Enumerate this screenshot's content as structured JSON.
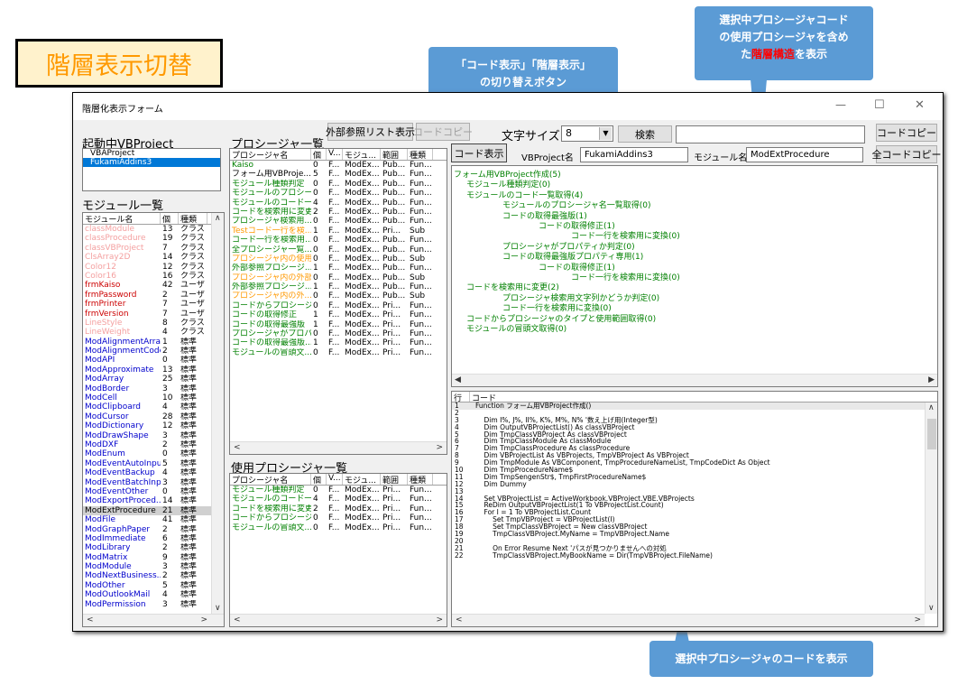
{
  "banner": "階層表示切替",
  "callouts": {
    "toggle": "「コード表示」「階層表示」\nの切り替えボタン",
    "hier_a": "選択中プロシージャコード\nの使用プロシージャを含め\nた",
    "hier_red": "階層構造",
    "hier_b": "を表示",
    "code": "選択中プロシージャのコードを表示"
  },
  "window": {
    "title": "階層化表示フォーム",
    "minimize": "—",
    "maximize": "☐",
    "close": "✕"
  },
  "left": {
    "running_label": "起動中VBProject",
    "projects": [
      "VBAProject",
      "FukamiAddins3"
    ],
    "module_label": "モジュール一覧",
    "module_cols": [
      "モジュール名",
      "個",
      "種類"
    ],
    "modules": [
      [
        "classModule",
        "13",
        "クラス",
        "#f4a0a0"
      ],
      [
        "classProcedure",
        "19",
        "クラス",
        "#f4a0a0"
      ],
      [
        "classVBProject",
        "7",
        "クラス",
        "#f4a0a0"
      ],
      [
        "ClsArray2D",
        "14",
        "クラス",
        "#f4a0a0"
      ],
      [
        "Color12",
        "12",
        "クラス",
        "#f4a0a0"
      ],
      [
        "Color16",
        "16",
        "クラス",
        "#f4a0a0"
      ],
      [
        "frmKaiso",
        "42",
        "ユーザ",
        "#cc0000"
      ],
      [
        "frmPassword",
        "2",
        "ユーザ",
        "#cc0000"
      ],
      [
        "frmPrinter",
        "7",
        "ユーザ",
        "#cc0000"
      ],
      [
        "frmVersion",
        "7",
        "ユーザ",
        "#cc0000"
      ],
      [
        "LineStyle",
        "8",
        "クラス",
        "#f4a0a0"
      ],
      [
        "LineWeight",
        "4",
        "クラス",
        "#f4a0a0"
      ],
      [
        "ModAlignmentArray",
        "1",
        "標準",
        "#0000cc"
      ],
      [
        "ModAlignmentCode",
        "2",
        "標準",
        "#0000cc"
      ],
      [
        "ModAPI",
        "0",
        "標準",
        "#0000cc"
      ],
      [
        "ModApproximate",
        "13",
        "標準",
        "#0000cc"
      ],
      [
        "ModArray",
        "25",
        "標準",
        "#0000cc"
      ],
      [
        "ModBorder",
        "3",
        "標準",
        "#0000cc"
      ],
      [
        "ModCell",
        "10",
        "標準",
        "#0000cc"
      ],
      [
        "ModClipboard",
        "4",
        "標準",
        "#0000cc"
      ],
      [
        "ModCursor",
        "28",
        "標準",
        "#0000cc"
      ],
      [
        "ModDictionary",
        "12",
        "標準",
        "#0000cc"
      ],
      [
        "ModDrawShape",
        "3",
        "標準",
        "#0000cc"
      ],
      [
        "ModDXF",
        "2",
        "標準",
        "#0000cc"
      ],
      [
        "ModEnum",
        "0",
        "標準",
        "#0000cc"
      ],
      [
        "ModEventAutoInput",
        "5",
        "標準",
        "#0000cc"
      ],
      [
        "ModEventBackup",
        "4",
        "標準",
        "#0000cc"
      ],
      [
        "ModEventBatchInp...",
        "3",
        "標準",
        "#0000cc"
      ],
      [
        "ModEventOther",
        "0",
        "標準",
        "#0000cc"
      ],
      [
        "ModExportProced...",
        "14",
        "標準",
        "#0000cc"
      ],
      [
        "ModExtProcedure",
        "21",
        "標準",
        "#000000"
      ],
      [
        "ModFile",
        "41",
        "標準",
        "#0000cc"
      ],
      [
        "ModGraphPaper",
        "2",
        "標準",
        "#0000cc"
      ],
      [
        "ModImmediate",
        "6",
        "標準",
        "#0000cc"
      ],
      [
        "ModLibrary",
        "2",
        "標準",
        "#0000cc"
      ],
      [
        "ModMatrix",
        "9",
        "標準",
        "#0000cc"
      ],
      [
        "ModModule",
        "3",
        "標準",
        "#0000cc"
      ],
      [
        "ModNextBusiness...",
        "2",
        "標準",
        "#0000cc"
      ],
      [
        "ModOther",
        "5",
        "標準",
        "#0000cc"
      ],
      [
        "ModOutlookMail",
        "4",
        "標準",
        "#0000cc"
      ],
      [
        "ModPermission",
        "3",
        "標準",
        "#0000cc"
      ]
    ]
  },
  "middle": {
    "proc_label": "プロシージャ一覧",
    "ext_ref_button": "外部参照リスト表示",
    "code_copy_disabled": "コードコピー",
    "proc_cols": [
      "プロシージャ名",
      "個",
      "V...",
      "モジュ...",
      "範囲",
      "種類"
    ],
    "procs": [
      [
        "Kaiso",
        "0",
        "F...",
        "ModEx...",
        "Pub...",
        "Fun...",
        "#008000"
      ],
      [
        "フォーム用VBProje...",
        "5",
        "F...",
        "ModEx...",
        "Pub...",
        "Fun...",
        "#000000"
      ],
      [
        "モジュール種類判定",
        "0",
        "F...",
        "ModEx...",
        "Pub...",
        "Fun...",
        "#008000"
      ],
      [
        "モジュールのプロシー...",
        "0",
        "F...",
        "ModEx...",
        "Pub...",
        "Fun...",
        "#008000"
      ],
      [
        "モジュールのコード一...",
        "4",
        "F...",
        "ModEx...",
        "Pub...",
        "Fun...",
        "#008000"
      ],
      [
        "コードを検索用に変更",
        "2",
        "F...",
        "ModEx...",
        "Pub...",
        "Fun...",
        "#008000"
      ],
      [
        "プロシージャ検索用...",
        "0",
        "F...",
        "ModEx...",
        "Pub...",
        "Fun...",
        "#008000"
      ],
      [
        "Testコード一行を検...",
        "1",
        "F...",
        "ModEx...",
        "Pri...",
        "Sub",
        "#ff9900"
      ],
      [
        "コード一行を検索用...",
        "0",
        "F...",
        "ModEx...",
        "Pub...",
        "Fun...",
        "#008000"
      ],
      [
        "全プロシージャ一覧...",
        "0",
        "F...",
        "ModEx...",
        "Pub...",
        "Fun...",
        "#008000"
      ],
      [
        "プロシージャ内の使用...",
        "0",
        "F...",
        "ModEx...",
        "Pub...",
        "Sub",
        "#ff9900"
      ],
      [
        "外部参照プロシージ...",
        "1",
        "F...",
        "ModEx...",
        "Pub...",
        "Fun...",
        "#008000"
      ],
      [
        "プロシージャ内の外部...",
        "0",
        "F...",
        "ModEx...",
        "Pub...",
        "Sub",
        "#ff9900"
      ],
      [
        "外部参照プロシージ...",
        "1",
        "F...",
        "ModEx...",
        "Pub...",
        "Fun...",
        "#008000"
      ],
      [
        "プロシージャ内の外...",
        "0",
        "F...",
        "ModEx...",
        "Pub...",
        "Sub",
        "#ff9900"
      ],
      [
        "コードからプロシージ...",
        "0",
        "F...",
        "ModEx...",
        "Pri...",
        "Fun...",
        "#008000"
      ],
      [
        "コードの取得修正",
        "1",
        "F...",
        "ModEx...",
        "Pri...",
        "Fun...",
        "#008000"
      ],
      [
        "コードの取得最強版",
        "1",
        "F...",
        "ModEx...",
        "Pri...",
        "Fun...",
        "#008000"
      ],
      [
        "プロシージャがプロパ...",
        "0",
        "F...",
        "ModEx...",
        "Pri...",
        "Fun...",
        "#008000"
      ],
      [
        "コードの取得最強版...",
        "1",
        "F...",
        "ModEx...",
        "Pri...",
        "Fun...",
        "#008000"
      ],
      [
        "モジュールの冒頭文...",
        "0",
        "F...",
        "ModEx...",
        "Pri...",
        "Fun...",
        "#008000"
      ]
    ],
    "used_label": "使用プロシージャ一覧",
    "used_cols": [
      "プロシージャ名",
      "個",
      "V...",
      "モジュ...",
      "範囲",
      "種類"
    ],
    "used": [
      [
        "モジュール種類判定",
        "0",
        "F...",
        "ModEx...",
        "Pri...",
        "Fun..."
      ],
      [
        "モジュールのコード一...",
        "4",
        "F...",
        "ModEx...",
        "Pri...",
        "Fun..."
      ],
      [
        "コードを検索用に変更",
        "2",
        "F...",
        "ModEx...",
        "Pri...",
        "Fun..."
      ],
      [
        "コードからプロシージ...",
        "0",
        "F...",
        "ModEx...",
        "Pri...",
        "Fun..."
      ],
      [
        "モジュールの冒頭文...",
        "0",
        "F...",
        "ModEx...",
        "Pri...",
        "Fun..."
      ]
    ]
  },
  "right": {
    "font_size_label": "文字サイズ",
    "font_size_value": "8",
    "search_button": "検索",
    "search_value": "",
    "code_copy_button": "コードコピー",
    "all_code_copy_button": "全コードコピー",
    "code_view_button": "コード表示",
    "vbproject_label": "VBProject名",
    "vbproject_value": "FukamiAddins3",
    "module_name_label": "モジュール名",
    "module_name_value": "ModExtProcedure",
    "tree": [
      "フォーム用VBProject作成(5)",
      "モジュール種類判定(0)",
      "モジュールのコード一覧取得(4)",
      "モジュールのプロシージャ名一覧取得(0)",
      "コードの取得最強版(1)",
      "コードの取得修正(1)",
      "コード一行を検索用に変換(0)",
      "プロシージャがプロパティか判定(0)",
      "コードの取得最強版プロパティ専用(1)",
      "コードの取得修正(1)",
      "コード一行を検索用に変換(0)",
      "コードを検索用に変更(2)",
      "プロシージャ検索用文字列かどうか判定(0)",
      "コード一行を検索用に変換(0)",
      "コードからプロシージャのタイプと使用範囲取得(0)",
      "モジュールの冒頭文取得(0)"
    ],
    "code_cols": [
      "行",
      "コード"
    ],
    "code": [
      [
        "1",
        "Function フォーム用VBProject作成()"
      ],
      [
        "2",
        ""
      ],
      [
        "3",
        "    Dim I%, J%, II%, K%, M%, N% '数え上げ用(Integer型)"
      ],
      [
        "4",
        "    Dim OutputVBProjectList() As classVBProject"
      ],
      [
        "5",
        "    Dim TmpClassVBProject As classVBProject"
      ],
      [
        "6",
        "    Dim TmpClassModule As classModule"
      ],
      [
        "7",
        "    Dim TmpClassProcedure As classProcedure"
      ],
      [
        "8",
        "    Dim VBProjectList As VBProjects, TmpVBProject As VBProject"
      ],
      [
        "9",
        "    Dim TmpModule As VBComponent, TmpProcedureNameList, TmpCodeDict As Object"
      ],
      [
        "10",
        "    Dim TmpProcedureName$"
      ],
      [
        "11",
        "    Dim TmpSengenStr$, TmpFirstProcedureName$"
      ],
      [
        "12",
        "    Dim Dummy"
      ],
      [
        "13",
        ""
      ],
      [
        "14",
        "    Set VBProjectList = ActiveWorkbook.VBProject.VBE.VBProjects"
      ],
      [
        "15",
        "    ReDim OutputVBProjectList(1 To VBProjectList.Count)"
      ],
      [
        "16",
        "    For I = 1 To VBProjectList.Count"
      ],
      [
        "17",
        "        Set TmpVBProject = VBProjectList(I)"
      ],
      [
        "18",
        "        Set TmpClassVBProject = New classVBProject"
      ],
      [
        "19",
        "        TmpClassVBProject.MyName = TmpVBProject.Name"
      ],
      [
        "20",
        ""
      ],
      [
        "21",
        "        On Error Resume Next 'パスが見つかりませんへの対処"
      ],
      [
        "22",
        "        TmpClassVBProject.MyBookName = Dir(TmpVBProject.FileName)"
      ]
    ]
  }
}
